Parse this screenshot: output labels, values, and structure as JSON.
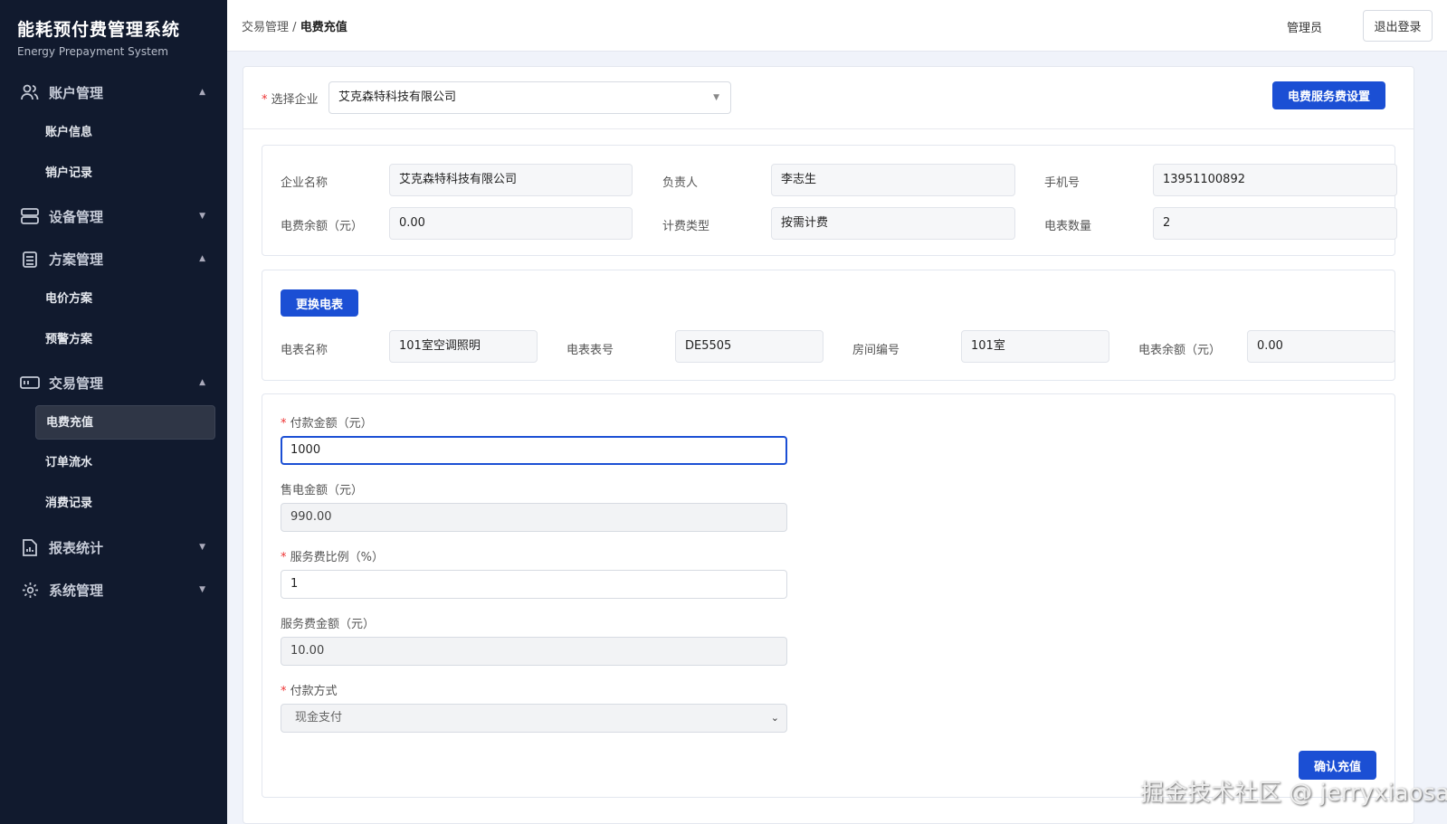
{
  "app": {
    "title": "能耗预付费管理系统",
    "subtitle": "Energy Prepayment System"
  },
  "sidebar": [
    {
      "label": "账户管理",
      "icon": "users-icon",
      "expanded": true,
      "items": [
        "账户信息",
        "销户记录"
      ]
    },
    {
      "label": "设备管理",
      "icon": "server-icon",
      "expanded": false,
      "items": []
    },
    {
      "label": "方案管理",
      "icon": "clipboard-icon",
      "expanded": true,
      "items": [
        "电价方案",
        "预警方案"
      ]
    },
    {
      "label": "交易管理",
      "icon": "card-icon",
      "expanded": true,
      "items": [
        "电费充值",
        "订单流水",
        "消费记录"
      ]
    },
    {
      "label": "报表统计",
      "icon": "report-icon",
      "expanded": false,
      "items": []
    },
    {
      "label": "系统管理",
      "icon": "gear-icon",
      "expanded": false,
      "items": []
    }
  ],
  "active_item": "电费充值",
  "header": {
    "crumb_parent": "交易管理",
    "crumb_sep": "/",
    "crumb_current": "电费充值",
    "user": "管理员",
    "logout": "退出登录"
  },
  "select": {
    "label": "选择企业",
    "value": "艾克森特科技有限公司",
    "settings_button": "电费服务费设置"
  },
  "company": {
    "name_label": "企业名称",
    "name": "艾克森特科技有限公司",
    "owner_label": "负责人",
    "owner": "李志生",
    "phone_label": "手机号",
    "phone": "13951100892",
    "balance_label": "电费余额（元）",
    "balance": "0.00",
    "billing_label": "计费类型",
    "billing": "按需计费",
    "meters_label": "电表数量",
    "meters": "2"
  },
  "meter": {
    "change_button": "更换电表",
    "name_label": "电表名称",
    "name": "101室空调照明",
    "no_label": "电表表号",
    "no": "DE5505",
    "room_label": "房间编号",
    "room": "101室",
    "balance_label": "电表余额（元）",
    "balance": "0.00"
  },
  "form": {
    "pay_label": "付款金额（元）",
    "pay": "1000",
    "sale_label": "售电金额（元）",
    "sale": "990.00",
    "ratio_label": "服务费比例（%）",
    "ratio": "1",
    "fee_label": "服务费金额（元）",
    "fee": "10.00",
    "method_label": "付款方式",
    "method": "现金支付",
    "confirm": "确认充值"
  },
  "watermark": "掘金技术社区 @ jerryxiaosa"
}
